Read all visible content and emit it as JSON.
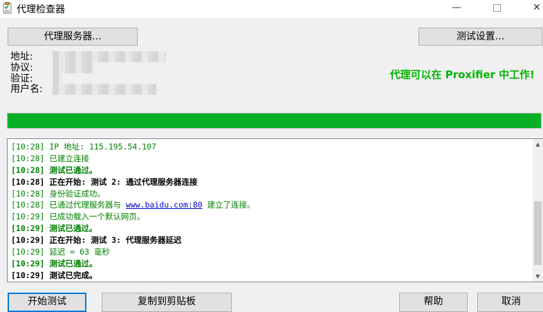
{
  "window": {
    "title": "代理检查器",
    "minimize": "—",
    "close": "✕"
  },
  "toolbar": {
    "proxy_servers_label": "代理服务器...",
    "test_settings_label": "测试设置..."
  },
  "info": {
    "address_label": "地址:",
    "protocol_label": "协议:",
    "auth_label": "验证:",
    "username_label": "用户名:"
  },
  "status_message": "代理可以在 Proxifier 中工作!",
  "progress": {
    "value_percent": 100,
    "color": "#06b025"
  },
  "log": {
    "lines": [
      {
        "text": "[10:28] IP 地址: 115.195.54.107",
        "color": "green",
        "bold": false
      },
      {
        "text": "[10:28] 已建立连接",
        "color": "green",
        "bold": false
      },
      {
        "text": "[10:28] 测试已通过。",
        "color": "green",
        "bold": true
      },
      {
        "text": "[10:28] 正在开始: 测试 2: 通过代理服务器连接",
        "color": "black",
        "bold": true
      },
      {
        "text": "[10:28] 身份验证成功。",
        "color": "green",
        "bold": false
      },
      {
        "prefix": "[10:28] 已通过代理服务器与 ",
        "link": "www.baidu.com:80",
        "suffix": " 建立了连接。",
        "color": "green",
        "bold": false
      },
      {
        "text": "[10:29] 已成功载入一个默认网页。",
        "color": "green",
        "bold": false
      },
      {
        "text": "[10:29] 测试已通过。",
        "color": "green",
        "bold": true
      },
      {
        "text": "[10:29] 正在开始: 测试 3: 代理服务器延迟",
        "color": "black",
        "bold": true
      },
      {
        "text": "[10:29] 延迟 = 63 毫秒",
        "color": "green",
        "bold": false
      },
      {
        "text": "[10:29] 测试已通过。",
        "color": "green",
        "bold": true
      },
      {
        "text": "[10:29] 测试已完成。",
        "color": "black",
        "bold": true
      }
    ]
  },
  "buttons": {
    "start_test": "开始测试",
    "copy_clipboard": "复制到剪贴板",
    "help": "帮助",
    "cancel": "取消"
  }
}
